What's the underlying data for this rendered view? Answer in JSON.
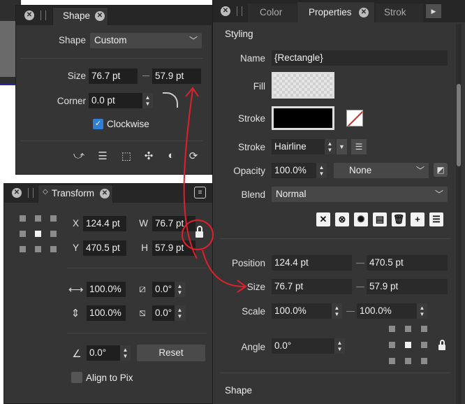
{
  "shape_panel": {
    "tab": "Shape",
    "shape_label": "Shape",
    "shape_value": "Custom",
    "size_label": "Size",
    "size_w": "76.7 pt",
    "size_h": "57.9 pt",
    "corner_label": "Corner",
    "corner_value": "0.0 pt",
    "clockwise_label": "Clockwise"
  },
  "transform_panel": {
    "tab": "Transform",
    "x_label": "X",
    "x_value": "124.4 pt",
    "y_label": "Y",
    "y_value": "470.5 pt",
    "w_label": "W",
    "w_value": "76.7 pt",
    "h_label": "H",
    "h_value": "57.9 pt",
    "scale_x": "100.0%",
    "scale_y": "100.0%",
    "shear_x": "0.0°",
    "shear_y": "0.0°",
    "rotation": "0.0°",
    "reset_label": "Reset",
    "align_label": "Align to Pix"
  },
  "props_panel": {
    "tabs": [
      "Color",
      "Properties",
      "Strok"
    ],
    "styling_heading": "Styling",
    "name_label": "Name",
    "name_value": "{Rectangle}",
    "fill_label": "Fill",
    "stroke_label": "Stroke",
    "stroke_style_label": "Stroke",
    "stroke_style_value": "Hairline",
    "opacity_label": "Opacity",
    "opacity_value": "100.0%",
    "opacity_mode": "None",
    "blend_label": "Blend",
    "blend_value": "Normal",
    "position_label": "Position",
    "position_x": "124.4 pt",
    "position_y": "470.5 pt",
    "size_label": "Size",
    "size_w": "76.7 pt",
    "size_h": "57.9 pt",
    "scale_label": "Scale",
    "scale_x": "100.0%",
    "scale_y": "100.0%",
    "angle_label": "Angle",
    "angle_value": "0.0°",
    "shape_heading": "Shape"
  },
  "colors": {
    "panel_bg": "#353535",
    "field_bg": "#1f1f1f",
    "accent": "#2f7fd6",
    "annotation": "#e0202c"
  }
}
